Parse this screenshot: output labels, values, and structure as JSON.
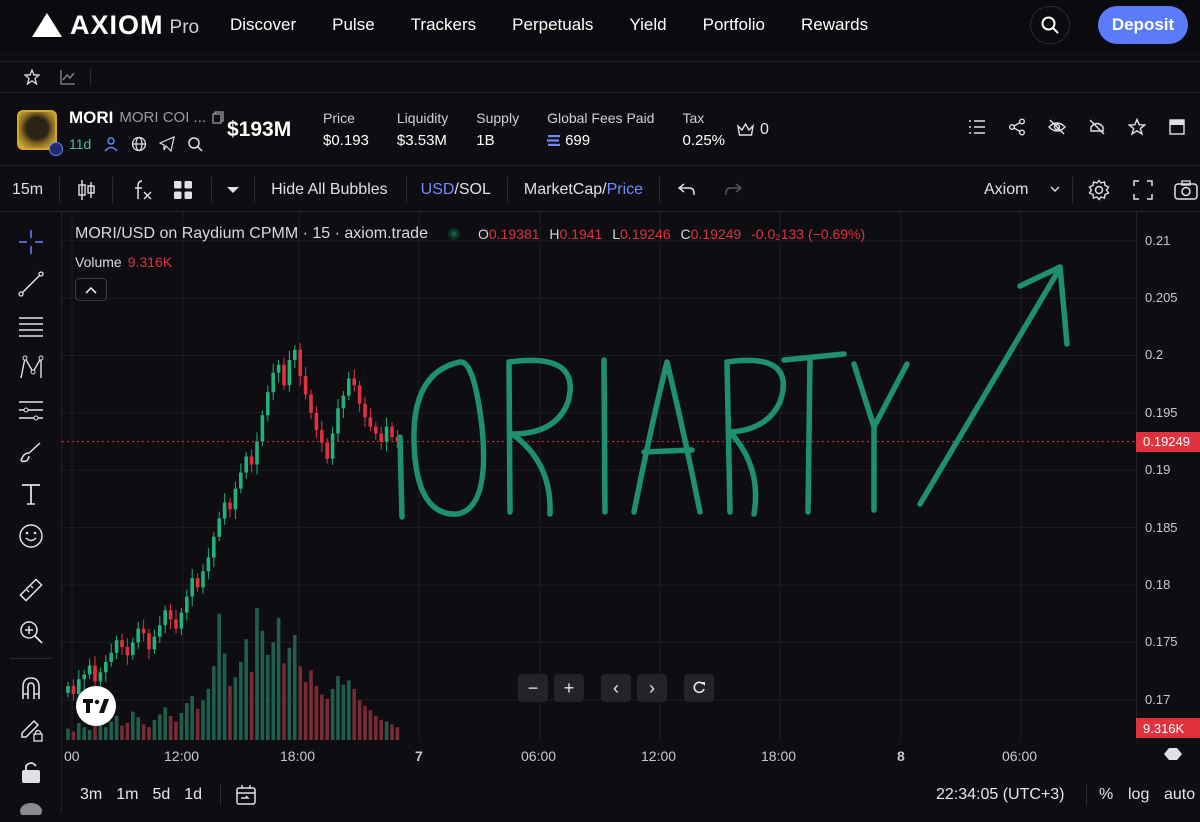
{
  "nav": {
    "brand": "AXIOM",
    "brand_suffix": "Pro",
    "links": [
      "Discover",
      "Pulse",
      "Trackers",
      "Perpetuals",
      "Yield",
      "Portfolio",
      "Rewards"
    ],
    "deposit_label": "Deposit"
  },
  "token": {
    "symbol": "MORI",
    "name": "MORI COI ...",
    "age": "11d",
    "market_cap": "$193M",
    "stats": [
      {
        "label": "Price",
        "value": "$0.193"
      },
      {
        "label": "Liquidity",
        "value": "$3.53M"
      },
      {
        "label": "Supply",
        "value": "1B"
      },
      {
        "label": "Global Fees Paid",
        "value": "699"
      },
      {
        "label": "Tax",
        "value": "0.25%"
      }
    ],
    "crown_count": "0"
  },
  "toolbar": {
    "interval": "15m",
    "hide_bubbles": "Hide All Bubbles",
    "currency_a": "USD",
    "currency_b": "SOL",
    "mode_a": "MarketCap",
    "mode_b": "Price",
    "theme": "Axiom"
  },
  "legend": {
    "title": "MORI/USD on Raydium CPMM · 15 · axiom.trade",
    "o": "0.19381",
    "h": "0.1941",
    "l": "0.19246",
    "c": "0.19249",
    "change": "-0.0₂133 (−0.69%)",
    "volume_label": "Volume",
    "volume_value": "9.316K"
  },
  "chart_data": {
    "type": "candlestick",
    "y_ticks": [
      "0.21",
      "0.205",
      "0.2",
      "0.195",
      "0.19",
      "0.185",
      "0.18",
      "0.175",
      "0.17"
    ],
    "ylim": [
      0.1665,
      0.2125
    ],
    "x_ticks": [
      "00",
      "12:00",
      "18:00",
      "7",
      "06:00",
      "12:00",
      "18:00",
      "8",
      "06:00"
    ],
    "last_price": "0.19249",
    "last_volume": "9.316K",
    "annotation": "ORIARTY",
    "close": [
      0.1712,
      0.1705,
      0.1718,
      0.1722,
      0.173,
      0.1716,
      0.1724,
      0.1733,
      0.1741,
      0.1752,
      0.1746,
      0.1739,
      0.175,
      0.1762,
      0.1758,
      0.1744,
      0.1755,
      0.1765,
      0.1778,
      0.177,
      0.1762,
      0.1776,
      0.179,
      0.1806,
      0.1798,
      0.1812,
      0.1824,
      0.1842,
      0.1858,
      0.1872,
      0.1866,
      0.1884,
      0.1898,
      0.1912,
      0.1905,
      0.1925,
      0.1948,
      0.1968,
      0.1985,
      0.1992,
      0.1974,
      0.1996,
      0.2005,
      0.1982,
      0.1966,
      0.195,
      0.1935,
      0.1924,
      0.191,
      0.1932,
      0.1954,
      0.1965,
      0.198,
      0.1974,
      0.1958,
      0.1946,
      0.1938,
      0.1932,
      0.1925,
      0.1938,
      0.1929,
      0.19249
    ],
    "volume": [
      800,
      600,
      1200,
      900,
      700,
      1100,
      1500,
      900,
      1300,
      1700,
      1000,
      1200,
      2000,
      1600,
      1100,
      900,
      1400,
      1800,
      2300,
      1700,
      1300,
      1900,
      2600,
      3100,
      2200,
      2800,
      3600,
      5200,
      8900,
      6100,
      3800,
      4400,
      5500,
      7100,
      4800,
      9300,
      7700,
      6000,
      6900,
      8600,
      5400,
      6500,
      7400,
      5200,
      4100,
      4900,
      3800,
      3200,
      2900,
      3600,
      4500,
      3900,
      4200,
      3600,
      2800,
      2400,
      2100,
      1700,
      1400,
      1300,
      1100,
      900
    ]
  }
}
